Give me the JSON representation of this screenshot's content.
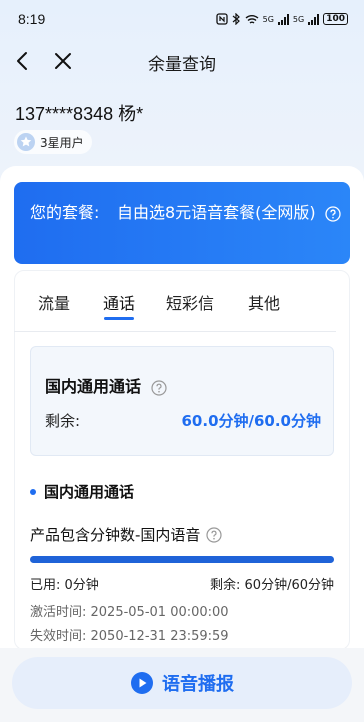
{
  "status_bar": {
    "time": "8:19",
    "signal1": "5G",
    "signal2": "5G",
    "battery": "100"
  },
  "nav": {
    "title": "余量查询"
  },
  "user": {
    "phone": "137****8348 杨*",
    "level": "3星用户"
  },
  "plan": {
    "label": "您的套餐:",
    "name": "自由选8元语音套餐(全网版)"
  },
  "tabs": [
    "流量",
    "通话",
    "短彩信",
    "其他"
  ],
  "active_tab": "通话",
  "summary": {
    "title": "国内通用通话",
    "label": "剩余:",
    "value": "60.0分钟/60.0分钟"
  },
  "section": {
    "title": "国内通用通话"
  },
  "item": {
    "title": "产品包含分钟数-国内语音",
    "progress_remaining": 1.0,
    "used": "已用: 0分钟",
    "remaining": "剩余: 60分钟/60分钟",
    "activated": "激活时间: 2025-05-01 00:00:00",
    "expires": "失效时间: 2050-12-31 23:59:59"
  },
  "voice_button": {
    "label": "语音播报"
  },
  "colors": {
    "accent": "#1f6df0",
    "banner": "#2b86f8"
  }
}
